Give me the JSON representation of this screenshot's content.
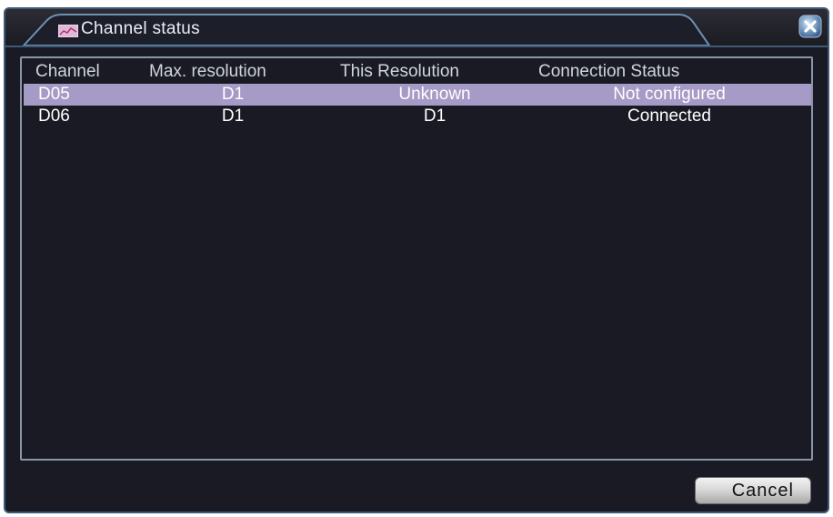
{
  "window": {
    "title": "Channel status",
    "title_icon": "channel-status-icon",
    "close_icon": "close-icon"
  },
  "table": {
    "columns": [
      "Channel",
      "Max. resolution",
      "This Resolution",
      "Connection Status"
    ],
    "rows": [
      {
        "channel": "D05",
        "max_resolution": "D1",
        "this_resolution": "Unknown",
        "connection_status": "Not configured",
        "selected": true
      },
      {
        "channel": "D06",
        "max_resolution": "D1",
        "this_resolution": "D1",
        "connection_status": "Connected",
        "selected": false
      }
    ]
  },
  "buttons": {
    "cancel_label": "Cancel"
  },
  "colors": {
    "selected_row": "#a69ac6",
    "window_border": "#3f5a76",
    "background": "#1a1a24"
  }
}
